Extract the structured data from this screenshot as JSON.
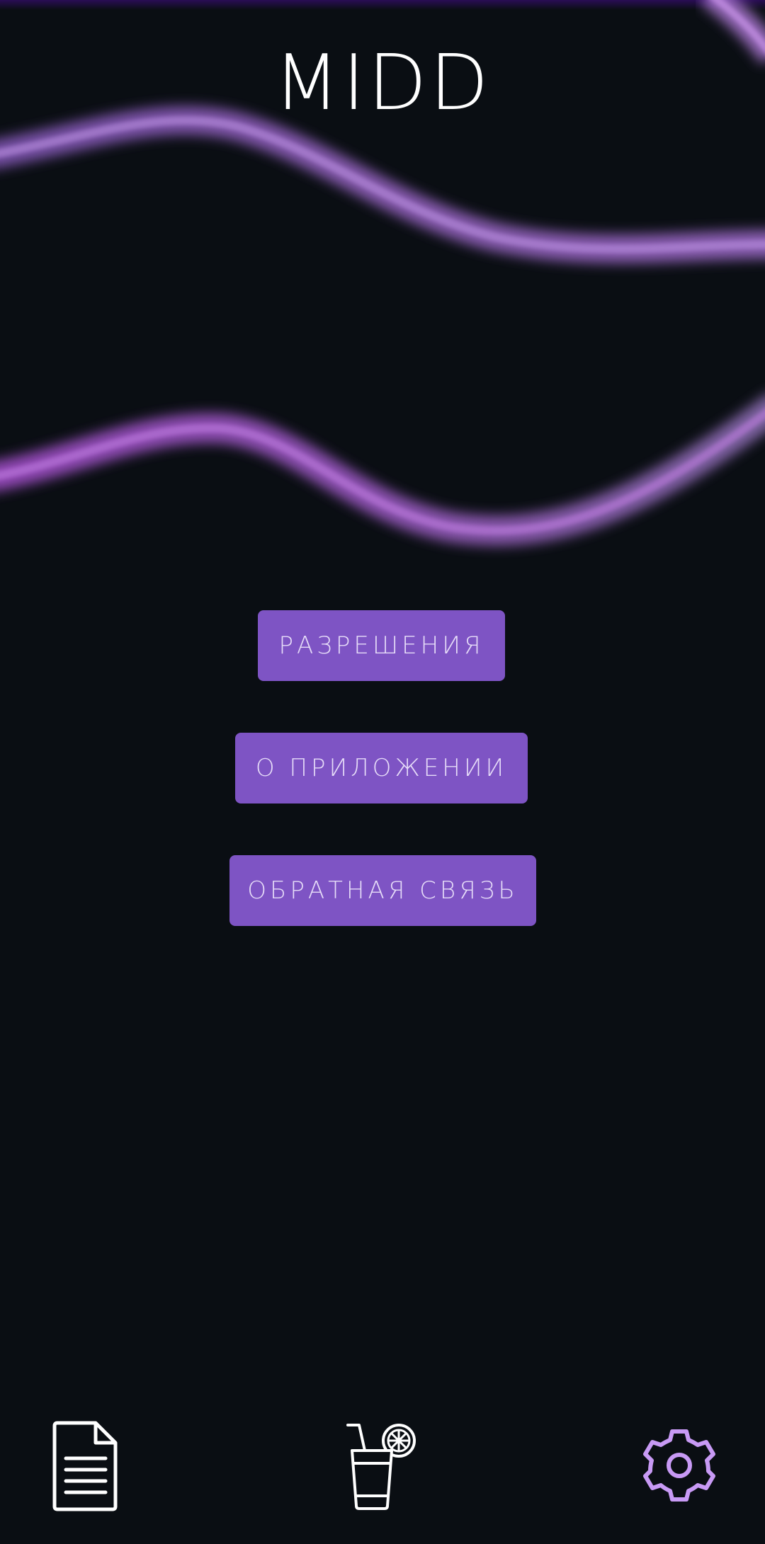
{
  "app": {
    "title": "MIDD"
  },
  "menu": {
    "buttons": [
      {
        "label": "РАЗРЕШЕНИЯ"
      },
      {
        "label": "О ПРИЛОЖЕНИИ"
      },
      {
        "label": "ОБРАТНАЯ СВЯЗЬ"
      }
    ]
  },
  "bottom_nav": {
    "items": [
      {
        "icon": "document-icon",
        "active": false
      },
      {
        "icon": "drink-icon",
        "active": false
      },
      {
        "icon": "gear-icon",
        "active": true
      }
    ]
  },
  "colors": {
    "background": "#0a0e13",
    "accent": "#7e54c4",
    "button_text": "#e6dcf8",
    "wave": "#9b5cd0",
    "active_icon": "#c89af5",
    "inactive_icon": "#ffffff"
  }
}
